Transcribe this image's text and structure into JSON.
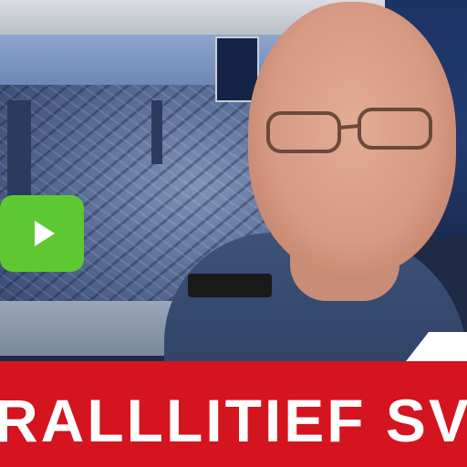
{
  "video": {
    "play_icon": "play-icon",
    "play_color": "#5ec832"
  },
  "banner": {
    "headline": "RALLLITIEF SV",
    "color": "#d4141f"
  }
}
